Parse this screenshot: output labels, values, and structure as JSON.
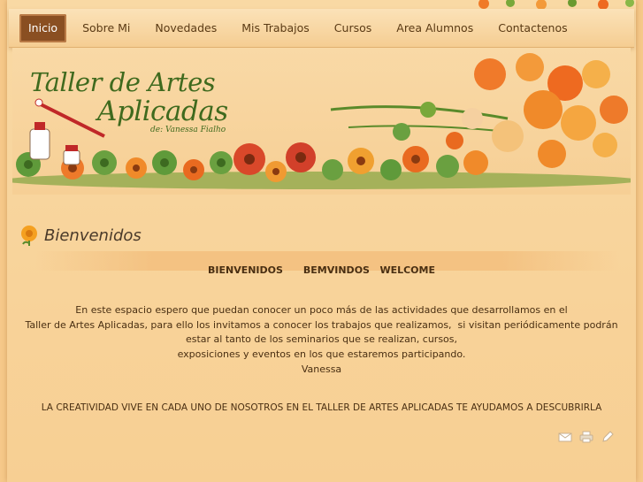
{
  "nav": {
    "items": [
      {
        "label": "Inicio",
        "active": true
      },
      {
        "label": "Sobre Mi",
        "active": false
      },
      {
        "label": "Novedades",
        "active": false
      },
      {
        "label": "Mis Trabajos",
        "active": false
      },
      {
        "label": "Cursos",
        "active": false
      },
      {
        "label": "Area Alumnos",
        "active": false
      },
      {
        "label": "Contactenos",
        "active": false
      }
    ]
  },
  "header": {
    "logo_line1": "Taller de Artes",
    "logo_line2": "Aplicadas",
    "logo_sub": "de: Vanessa Fialho"
  },
  "main": {
    "title": "Bienvenidos",
    "greeting": "BIENVENIDOS      BEMVINDOS   WELCOME",
    "intro_lines": [
      "En este espacio espero que puedan conocer un poco más de las actividades que desarrollamos en el",
      "Taller de Artes Aplicadas, para ello los invitamos a conocer los trabajos que realizamos,  si visitan periódicamente podrán",
      "estar al tanto de los seminarios que se realizan, cursos,",
      "exposiciones y eventos en los que estaremos participando.",
      "Vanessa"
    ],
    "motto": "LA CREATIVIDAD VIVE EN CADA UNO DE NOSOTROS EN EL TALLER DE ARTES APLICADAS TE AYUDAMOS A DESCUBRIRLA"
  },
  "icons": {
    "title_icon": "flower-icon",
    "actions": [
      "mail-icon",
      "print-icon",
      "edit-icon"
    ]
  },
  "colors": {
    "background": "#f6c98a",
    "nav_active": "#8a4f22",
    "logo_green": "#3f6a1e",
    "text": "#4a2f12"
  }
}
